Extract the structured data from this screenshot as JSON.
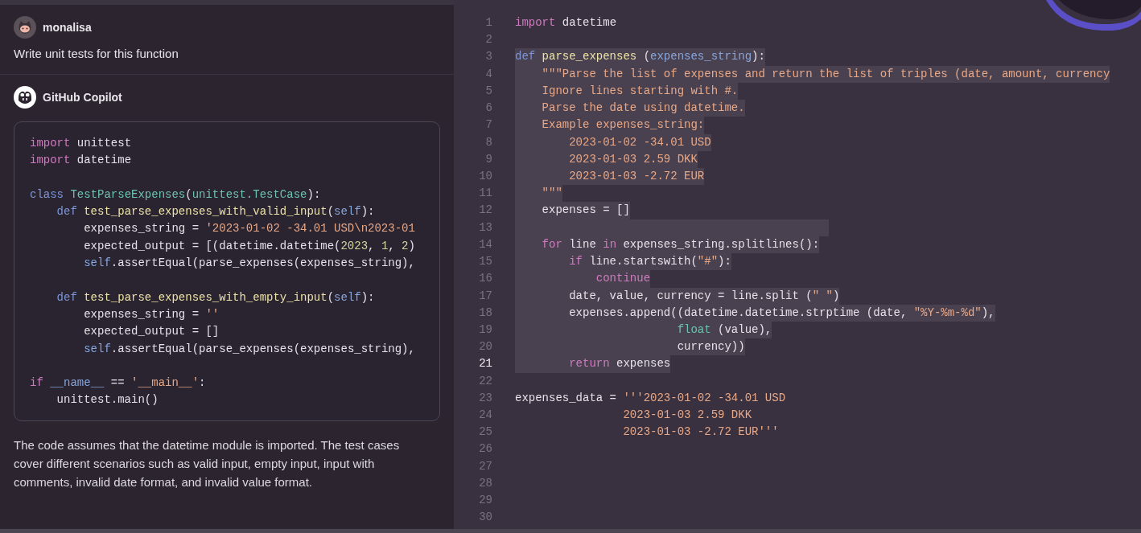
{
  "chat": {
    "messages": [
      {
        "kind": "user",
        "author": "monalisa",
        "text": "Write unit tests for this function"
      },
      {
        "kind": "assistant",
        "author": "GitHub Copilot",
        "code": [
          {
            "gap_before": false,
            "tokens": [
              {
                "kind": "keyword",
                "text": "import"
              },
              {
                "kind": "plain",
                "text": " unittest"
              }
            ]
          },
          {
            "gap_before": false,
            "tokens": [
              {
                "kind": "keyword",
                "text": "import"
              },
              {
                "kind": "plain",
                "text": " datetime"
              }
            ]
          },
          {
            "gap_before": true,
            "tokens": [
              {
                "kind": "storage",
                "text": "class "
              },
              {
                "kind": "type",
                "text": "TestParseExpenses"
              },
              {
                "kind": "plain",
                "text": "("
              },
              {
                "kind": "type",
                "text": "unittest.TestCase"
              },
              {
                "kind": "plain",
                "text": "):"
              }
            ]
          },
          {
            "gap_before": false,
            "tokens": [
              {
                "kind": "storage",
                "text": "    def "
              },
              {
                "kind": "function",
                "text": "test_parse_expenses_with_valid_input"
              },
              {
                "kind": "plain",
                "text": "("
              },
              {
                "kind": "param",
                "text": "self"
              },
              {
                "kind": "plain",
                "text": "):"
              }
            ]
          },
          {
            "gap_before": false,
            "tokens": [
              {
                "kind": "plain",
                "text": "        expenses_string = "
              },
              {
                "kind": "string",
                "text": "'2023-01-02 -34.01 USD\\n2023-01"
              }
            ]
          },
          {
            "gap_before": false,
            "tokens": [
              {
                "kind": "plain",
                "text": "        expected_output = [(datetime.datetime("
              },
              {
                "kind": "number",
                "text": "2023"
              },
              {
                "kind": "plain",
                "text": ", "
              },
              {
                "kind": "number",
                "text": "1"
              },
              {
                "kind": "plain",
                "text": ", "
              },
              {
                "kind": "number",
                "text": "2"
              },
              {
                "kind": "plain",
                "text": ")"
              }
            ]
          },
          {
            "gap_before": false,
            "tokens": [
              {
                "kind": "param",
                "text": "        self"
              },
              {
                "kind": "plain",
                "text": ".assertEqual(parse_expenses(expenses_string),"
              }
            ]
          },
          {
            "gap_before": true,
            "tokens": [
              {
                "kind": "storage",
                "text": "    def "
              },
              {
                "kind": "function",
                "text": "test_parse_expenses_with_empty_input"
              },
              {
                "kind": "plain",
                "text": "("
              },
              {
                "kind": "param",
                "text": "self"
              },
              {
                "kind": "plain",
                "text": "):"
              }
            ]
          },
          {
            "gap_before": false,
            "tokens": [
              {
                "kind": "plain",
                "text": "        expenses_string = "
              },
              {
                "kind": "string",
                "text": "''"
              }
            ]
          },
          {
            "gap_before": false,
            "tokens": [
              {
                "kind": "plain",
                "text": "        expected_output = []"
              }
            ]
          },
          {
            "gap_before": false,
            "tokens": [
              {
                "kind": "param",
                "text": "        self"
              },
              {
                "kind": "plain",
                "text": ".assertEqual(parse_expenses(expenses_string),"
              }
            ]
          },
          {
            "gap_before": true,
            "tokens": [
              {
                "kind": "keyword",
                "text": "if "
              },
              {
                "kind": "param",
                "text": "__name__"
              },
              {
                "kind": "plain",
                "text": " == "
              },
              {
                "kind": "string",
                "text": "'__main__'"
              },
              {
                "kind": "plain",
                "text": ":"
              }
            ]
          },
          {
            "gap_before": false,
            "tokens": [
              {
                "kind": "plain",
                "text": "    unittest.main()"
              }
            ]
          }
        ],
        "text": "The code assumes that the datetime module is imported. The test cases cover different scenarios such as valid input, empty input, input with comments, invalid date format, and invalid value format."
      }
    ]
  },
  "editor": {
    "lines": [
      {
        "number": "1",
        "selected": false,
        "current": false,
        "tokens": [
          {
            "kind": "keyword",
            "text": "import"
          },
          {
            "kind": "plain",
            "text": " datetime"
          }
        ]
      },
      {
        "number": "2",
        "selected": false,
        "current": false
      },
      {
        "number": "3",
        "selected": true,
        "current": false,
        "tokens": [
          {
            "kind": "storage",
            "text": "def "
          },
          {
            "kind": "function",
            "text": "parse_expenses"
          },
          {
            "kind": "plain",
            "text": " ("
          },
          {
            "kind": "param",
            "text": "expenses_string"
          },
          {
            "kind": "plain",
            "text": "):"
          }
        ]
      },
      {
        "number": "4",
        "selected": true,
        "current": false,
        "tokens": [
          {
            "kind": "string",
            "text": "    \"\"\"Parse the list of expenses and return the list of triples (date, amount, currency"
          }
        ]
      },
      {
        "number": "5",
        "selected": true,
        "current": false,
        "tokens": [
          {
            "kind": "string",
            "text": "    Ignore lines starting with #."
          }
        ]
      },
      {
        "number": "6",
        "selected": true,
        "current": false,
        "tokens": [
          {
            "kind": "string",
            "text": "    Parse the date using datetime."
          }
        ]
      },
      {
        "number": "7",
        "selected": true,
        "current": false,
        "tokens": [
          {
            "kind": "string",
            "text": "    Example expenses_string:"
          }
        ]
      },
      {
        "number": "8",
        "selected": true,
        "current": false,
        "tokens": [
          {
            "kind": "string",
            "text": "        2023-01-02 -34.01 USD"
          }
        ]
      },
      {
        "number": "9",
        "selected": true,
        "current": false,
        "tokens": [
          {
            "kind": "string",
            "text": "        2023-01-03 2.59 DKK"
          }
        ]
      },
      {
        "number": "10",
        "selected": true,
        "current": false,
        "tokens": [
          {
            "kind": "string",
            "text": "        2023-01-03 -2.72 EUR"
          }
        ]
      },
      {
        "number": "11",
        "selected": true,
        "current": false,
        "tokens": [
          {
            "kind": "string",
            "text": "    \"\"\""
          }
        ]
      },
      {
        "number": "12",
        "selected": true,
        "current": false,
        "tokens": [
          {
            "kind": "plain",
            "text": "    expenses = []"
          }
        ]
      },
      {
        "number": "13",
        "selected": true,
        "current": false
      },
      {
        "number": "14",
        "selected": true,
        "current": false,
        "tokens": [
          {
            "kind": "keyword",
            "text": "    for"
          },
          {
            "kind": "plain",
            "text": " line "
          },
          {
            "kind": "keyword",
            "text": "in"
          },
          {
            "kind": "plain",
            "text": " expenses_string.splitlines():"
          }
        ]
      },
      {
        "number": "15",
        "selected": true,
        "current": false,
        "tokens": [
          {
            "kind": "keyword",
            "text": "        if"
          },
          {
            "kind": "plain",
            "text": " line.startswith("
          },
          {
            "kind": "string",
            "text": "\"#\""
          },
          {
            "kind": "plain",
            "text": "):"
          }
        ]
      },
      {
        "number": "16",
        "selected": true,
        "current": false,
        "tokens": [
          {
            "kind": "keyword",
            "text": "            continue"
          }
        ]
      },
      {
        "number": "17",
        "selected": true,
        "current": false,
        "tokens": [
          {
            "kind": "plain",
            "text": "        date, value, currency = line.split ("
          },
          {
            "kind": "string",
            "text": "\" \""
          },
          {
            "kind": "plain",
            "text": ")"
          }
        ]
      },
      {
        "number": "18",
        "selected": true,
        "current": false,
        "tokens": [
          {
            "kind": "plain",
            "text": "        expenses.append((datetime.datetime.strptime (date, "
          },
          {
            "kind": "string",
            "text": "\"%Y-%m-%d\""
          },
          {
            "kind": "plain",
            "text": "),"
          }
        ]
      },
      {
        "number": "19",
        "selected": true,
        "current": false,
        "tokens": [
          {
            "kind": "type",
            "text": "                        float"
          },
          {
            "kind": "plain",
            "text": " (value),"
          }
        ]
      },
      {
        "number": "20",
        "selected": true,
        "current": false,
        "tokens": [
          {
            "kind": "plain",
            "text": "                        currency))"
          }
        ]
      },
      {
        "number": "21",
        "selected": true,
        "current": true,
        "tokens": [
          {
            "kind": "keyword",
            "text": "        return"
          },
          {
            "kind": "plain",
            "text": " expenses"
          }
        ]
      },
      {
        "number": "22",
        "selected": false,
        "current": false
      },
      {
        "number": "23",
        "selected": false,
        "current": false,
        "tokens": [
          {
            "kind": "plain",
            "text": "expenses_data = "
          },
          {
            "kind": "string",
            "text": "'''2023-01-02 -34.01 USD"
          }
        ]
      },
      {
        "number": "24",
        "selected": false,
        "current": false,
        "tokens": [
          {
            "kind": "string",
            "text": "                2023-01-03 2.59 DKK"
          }
        ]
      },
      {
        "number": "25",
        "selected": false,
        "current": false,
        "tokens": [
          {
            "kind": "string",
            "text": "                2023-01-03 -2.72 EUR'''"
          }
        ]
      },
      {
        "number": "26",
        "selected": false,
        "current": false
      },
      {
        "number": "27",
        "selected": false,
        "current": false
      },
      {
        "number": "28",
        "selected": false,
        "current": false
      },
      {
        "number": "29",
        "selected": false,
        "current": false
      },
      {
        "number": "30",
        "selected": false,
        "current": false
      }
    ]
  }
}
